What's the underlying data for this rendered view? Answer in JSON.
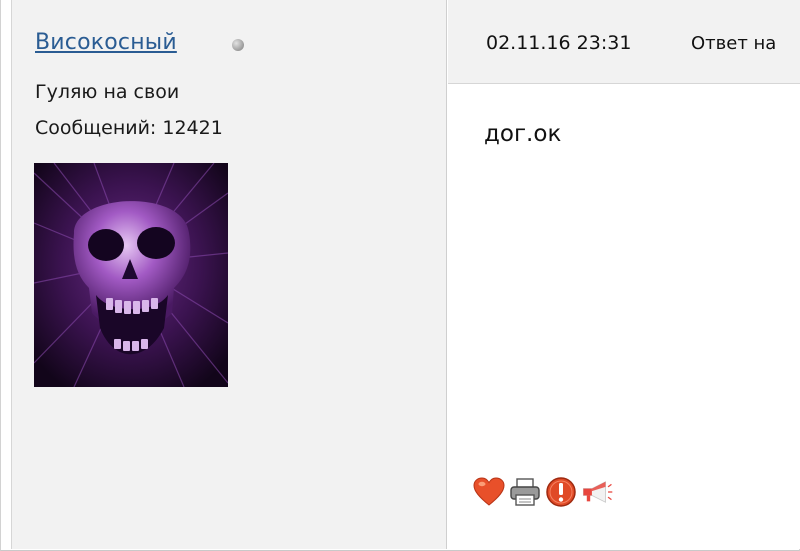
{
  "author": {
    "username": "Високосный",
    "status": "offline",
    "user_title": "Гуляю на свои",
    "message_count_text": "Сообщений: 12421",
    "avatar_icon": "purple-skull-avatar"
  },
  "post": {
    "date": "02.11.16 23:31",
    "reply_label": "Ответ на",
    "body": "дог.ок"
  },
  "actions": [
    {
      "icon": "heart-icon"
    },
    {
      "icon": "print-icon"
    },
    {
      "icon": "report-icon"
    },
    {
      "icon": "megaphone-icon"
    }
  ],
  "colors": {
    "username": "#2a5c93",
    "sidebar_bg": "#f2f2f2",
    "heart": "#e8502a",
    "report": "#e04a26",
    "avatar_tint": "#7a2fa0"
  }
}
